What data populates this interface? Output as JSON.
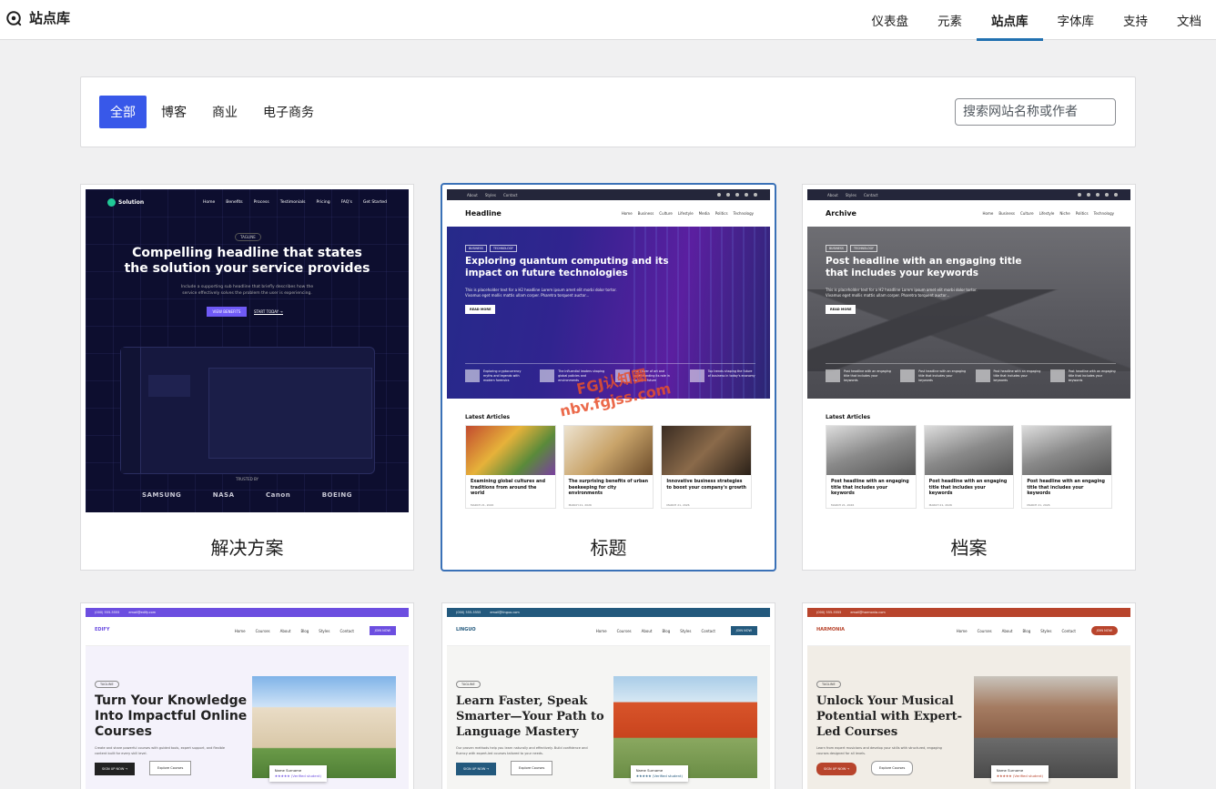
{
  "header": {
    "brand_title": "站点库",
    "nav": [
      {
        "label": "仪表盘",
        "active": false
      },
      {
        "label": "元素",
        "active": false
      },
      {
        "label": "站点库",
        "active": true
      },
      {
        "label": "字体库",
        "active": false
      },
      {
        "label": "支持",
        "active": false
      },
      {
        "label": "文档",
        "active": false
      }
    ]
  },
  "filters": {
    "tabs": [
      {
        "label": "全部",
        "active": true
      },
      {
        "label": "博客",
        "active": false
      },
      {
        "label": "商业",
        "active": false
      },
      {
        "label": "电子商务",
        "active": false
      }
    ],
    "search_placeholder": "搜索网站名称或作者"
  },
  "colors": {
    "accent": "#3858e9",
    "selected_border": "#3a71b7",
    "active_tab_underline": "#2271b1"
  },
  "cards": [
    {
      "label": "解决方案",
      "selected": false,
      "preview": {
        "logo": "Solution",
        "links": [
          "Home",
          "Benefits",
          "Process",
          "Testimonials",
          "Pricing",
          "FAQ's",
          "Get Started"
        ],
        "pill": "TAGLINE",
        "headline_line1": "Compelling headline that states",
        "headline_line2": "the solution your service provides",
        "sub": "Include a supporting sub headline that briefly describes how the service effectively solves the problem the user is experiencing.",
        "btn_primary": "VIEW BENEFITS",
        "btn_secondary": "START TODAY →",
        "trusted": "TRUSTED BY",
        "logos": [
          "SAMSUNG",
          "NASA",
          "Canon",
          "BOEING"
        ]
      }
    },
    {
      "label": "标题",
      "selected": true,
      "preview": {
        "topbar": [
          "About",
          "Styles",
          "Contact"
        ],
        "logo": "Headline",
        "links": [
          "Home",
          "Business",
          "Culture",
          "Lifestyle",
          "Media",
          "Politics",
          "Technology"
        ],
        "tags": [
          "BUSINESS",
          "TECHNOLOGY"
        ],
        "hero_title": "Exploring quantum computing and its impact on future technologies",
        "hero_text": "This is placeholder text for a H2 headline Lorem ipsum amet elit morbi dolor tortor. Vivamus eget mollis mattis ullam corper. Pharetra torquent auctor...",
        "read_more": "READ MORE",
        "minis": [
          "Exploring cryptocurrency myths and legends with modern forensics",
          "The influential leaders shaping global policies and environments",
          "The power of art and understanding its role in society's future",
          "Top trends shaping the future of business in today's economy"
        ],
        "latest": "Latest Articles",
        "articles": [
          {
            "title": "Examining global cultures and traditions from around the world",
            "date": "MARCH 21, 2026"
          },
          {
            "title": "The surprising benefits of urban beekeeping for city environments",
            "date": "MARCH 21, 2026"
          },
          {
            "title": "Innovative business strategies to boost your company's growth",
            "date": "MARCH 21, 2026"
          }
        ]
      }
    },
    {
      "label": "档案",
      "selected": false,
      "preview": {
        "topbar": [
          "About",
          "Styles",
          "Contact"
        ],
        "logo": "Archive",
        "links": [
          "Home",
          "Business",
          "Culture",
          "Lifestyle",
          "Niche",
          "Politics",
          "Technology"
        ],
        "tags": [
          "BUSINESS",
          "TECHNOLOGY"
        ],
        "hero_title": "Post headline with an engaging title that includes your keywords",
        "hero_text": "This is placeholder text for a H2 headline Lorem ipsum amet elit morbi dolor tortor. Vivamus eget mollis mattis ullam corper. Pharetra torquent auctor...",
        "read_more": "READ MORE",
        "minis": [
          "Post headline with an engaging title that includes your keywords",
          "Post headline with an engaging title that includes your keywords",
          "Post headline with an engaging title that includes your keywords",
          "Post headline with an engaging title that includes your keywords"
        ],
        "latest": "Latest Articles",
        "articles": [
          {
            "title": "Post headline with an engaging title that includes your keywords",
            "date": "MARCH 21, 2026"
          },
          {
            "title": "Post headline with an engaging title that includes your keywords",
            "date": "MARCH 21, 2026"
          },
          {
            "title": "Post headline with an engaging title that includes your keywords",
            "date": "MARCH 21, 2026"
          }
        ]
      }
    },
    {
      "preview": {
        "bar": [
          "(000) 555-5555",
          "email@edify.com"
        ],
        "logo": "EDIFY",
        "links": [
          "Home",
          "Courses",
          "About",
          "Blog",
          "Styles",
          "Contact"
        ],
        "join": "JOIN NOW",
        "tag": "TAGLINE",
        "title": "Turn Your Knowledge Into Impactful Online Courses",
        "desc": "Create and share powerful courses with guided tools, expert support, and flexible content built for every skill level.",
        "b1": "SIGN UP NOW →",
        "b2": "Explore Courses",
        "name": "Name Surname",
        "rating": "★★★★★ (Verified student)"
      }
    },
    {
      "preview": {
        "bar": [
          "(000) 555-5555",
          "email@linguo.com"
        ],
        "logo": "LINGUO",
        "links": [
          "Home",
          "Courses",
          "About",
          "Blog",
          "Styles",
          "Contact"
        ],
        "join": "JOIN NOW",
        "tag": "TAGLINE",
        "title": "Learn Faster, Speak Smarter—Your Path to Language Mastery",
        "desc": "Our proven methods help you learn naturally and effectively. Build confidence and fluency with expert-led courses tailored to your needs.",
        "b1": "SIGN UP NOW →",
        "b2": "Explore Courses",
        "name": "Name Surname",
        "rating": "★★★★★ (Verified student)"
      }
    },
    {
      "preview": {
        "bar": [
          "(000) 555-5555",
          "email@harmonia.com"
        ],
        "logo": "HARMONIA",
        "links": [
          "Home",
          "Courses",
          "About",
          "Blog",
          "Styles",
          "Contact"
        ],
        "join": "JOIN NOW",
        "tag": "TAGLINE",
        "title": "Unlock Your Musical Potential with Expert-Led Courses",
        "desc": "Learn from expert musicians and develop your skills with structured, engaging courses designed for all levels.",
        "b1": "SIGN UP NOW →",
        "b2": "Explore Courses",
        "name": "Name Surname",
        "rating": "★★★★★ (Verified student)"
      }
    }
  ],
  "watermark": {
    "line1": "FGJ认知圈",
    "line2": "nbv.fgjss.com"
  }
}
